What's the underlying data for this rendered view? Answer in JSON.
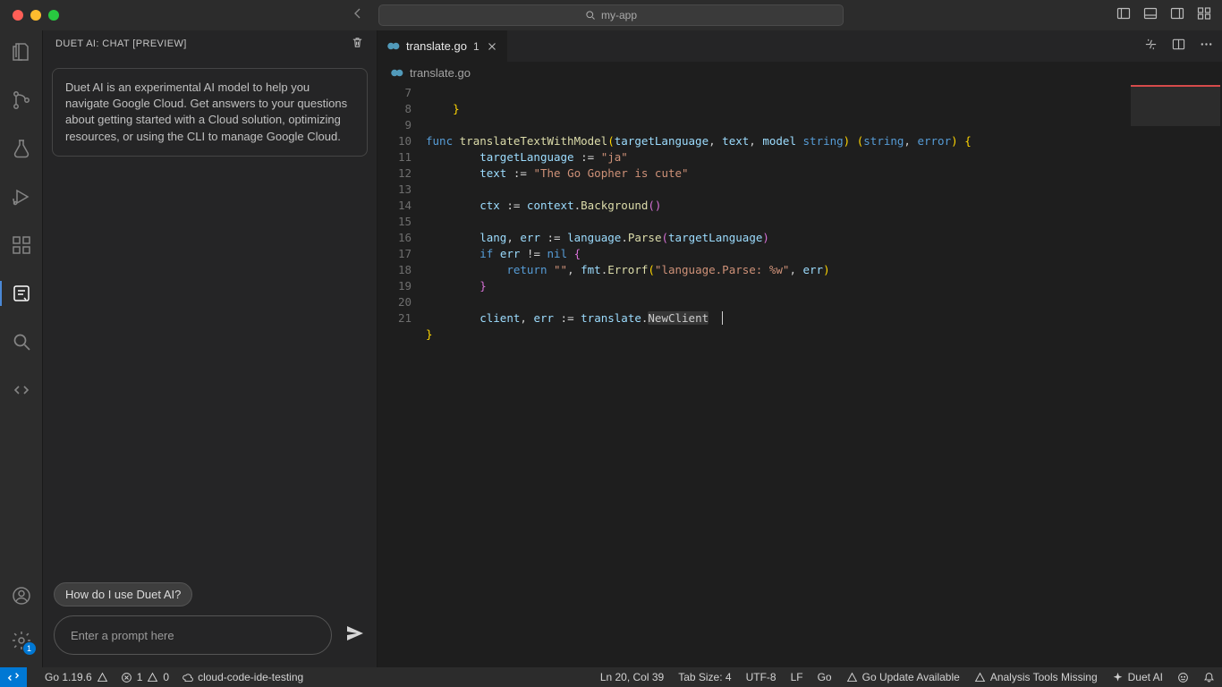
{
  "title": {
    "search": "my-app"
  },
  "sidepanel": {
    "header": "DUET AI: CHAT [PREVIEW]",
    "intro": "Duet AI is an experimental AI model to help you navigate Google Cloud. Get answers to your questions about getting started with a Cloud solution, optimizing resources, or using the CLI to manage Google Cloud.",
    "suggestion": "How do I use Duet AI?",
    "placeholder": "Enter a prompt here"
  },
  "tab": {
    "filename": "translate.go",
    "modified": "1"
  },
  "breadcrumb": "translate.go",
  "gutter": [
    "7",
    "8",
    "9",
    "10",
    "11",
    "12",
    "13",
    "14",
    "15",
    "16",
    "17",
    "18",
    "19",
    "20",
    "21"
  ],
  "code": {
    "l7": "    }",
    "l9_pre": "func ",
    "l9_fn": "translateTextWithModel",
    "l9_args": "(targetLanguage, text, model string) (string, error) {",
    "l10": "        targetLanguage := \"ja\"",
    "l11": "        text := \"The Go Gopher is cute\"",
    "l13": "        ctx := context.Background()",
    "l15": "        lang, err := language.Parse(targetLanguage)",
    "l16": "        if err != nil {",
    "l17": "            return \"\", fmt.Errorf(\"language.Parse: %w\", err)",
    "l18": "        }",
    "l20_a": "        client, err := translate.",
    "l20_b": "NewClient",
    "l21": "}"
  },
  "status": {
    "go": "Go 1.19.6",
    "errors": "1",
    "warnings": "0",
    "cloud": "cloud-code-ide-testing",
    "pos": "Ln 20, Col 39",
    "tab": "Tab Size: 4",
    "enc": "UTF-8",
    "eol": "LF",
    "lang": "Go",
    "upd": "Go Update Available",
    "tools": "Analysis Tools Missing",
    "duet": "Duet AI",
    "settings_badge": "1"
  }
}
